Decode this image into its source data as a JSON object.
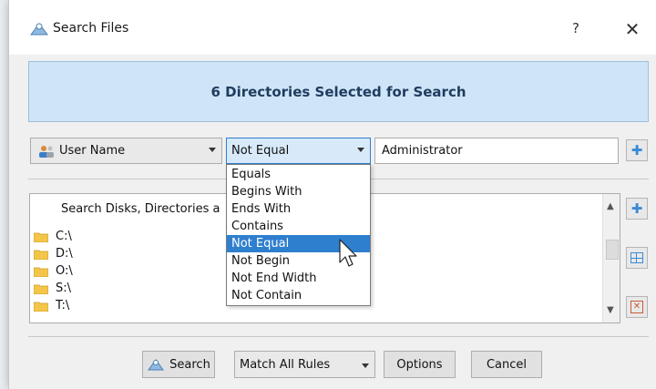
{
  "window": {
    "title": "Search Files",
    "help_label": "?",
    "close_label": "✕"
  },
  "banner": {
    "text": "6 Directories Selected for Search"
  },
  "rule": {
    "field": "User Name",
    "operator": "Not Equal",
    "value": "Administrator"
  },
  "operator_options": [
    "Equals",
    "Begins With",
    "Ends With",
    "Contains",
    "Not Equal",
    "Not Begin",
    "Not End Width",
    "Not Contain"
  ],
  "operator_selected_index": 4,
  "directories": {
    "header": "Search Disks, Directories a",
    "items": [
      "C:\\",
      "D:\\",
      "O:\\",
      "S:\\",
      "T:\\"
    ]
  },
  "footer": {
    "search_label": "Search",
    "match_mode": "Match All Rules",
    "options_label": "Options",
    "cancel_label": "Cancel"
  },
  "colors": {
    "accent": "#2f7fcf",
    "banner_bg": "#cfe5f7",
    "folder": "#f3c64a"
  },
  "icons": {
    "title": "search-files-icon",
    "field": "user-icon",
    "add_rule": "plus-icon",
    "add_dir": "plus-icon",
    "select_all": "grid-icon",
    "remove": "remove-icon",
    "folder": "folder-icon"
  }
}
